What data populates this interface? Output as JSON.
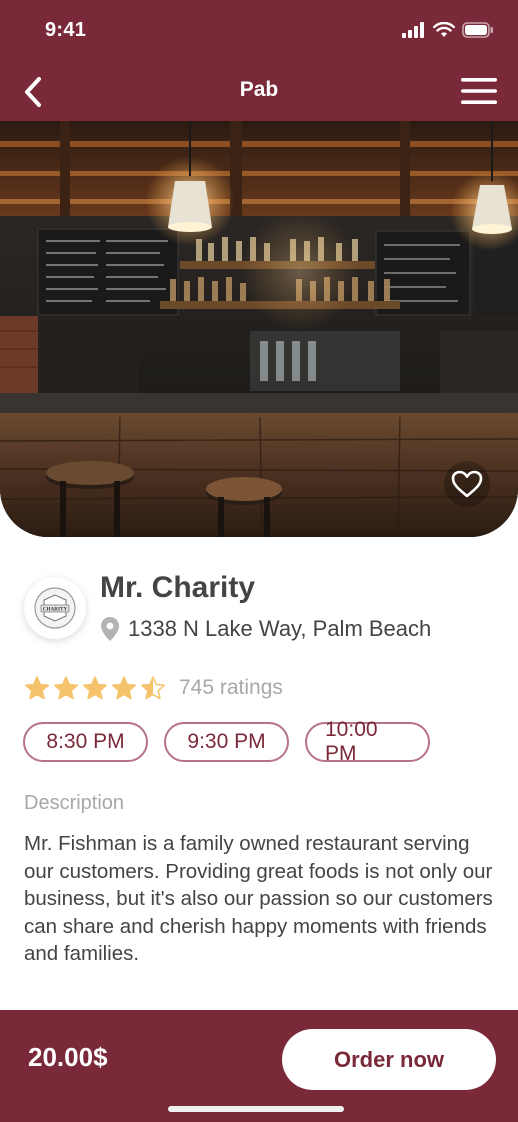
{
  "status_bar": {
    "time": "9:41"
  },
  "nav": {
    "title": "Pab"
  },
  "restaurant": {
    "name": "Mr. Charity",
    "address": "1338 N Lake Way, Palm Beach",
    "logo_text": "CHARITY",
    "rating": 4.5,
    "ratings_label": "745 ratings"
  },
  "times": [
    "8:30 PM",
    "9:30 PM",
    "10:00 PM"
  ],
  "description": {
    "label": "Description",
    "text": "Mr. Fishman is a family owned restaurant serving our customers. Providing great foods is not only our business, but it's also our passion so our customers can share and cherish happy moments with friends and families."
  },
  "footer": {
    "price": "20.00$",
    "order_label": "Order now"
  },
  "colors": {
    "brand": "#7a2939",
    "star": "#f5c36b",
    "muted": "#a8a8a8"
  },
  "icons": [
    "signal-icon",
    "wifi-icon",
    "battery-icon",
    "back-arrow-icon",
    "menu-icon",
    "heart-icon",
    "location-pin-icon",
    "star-icon"
  ]
}
